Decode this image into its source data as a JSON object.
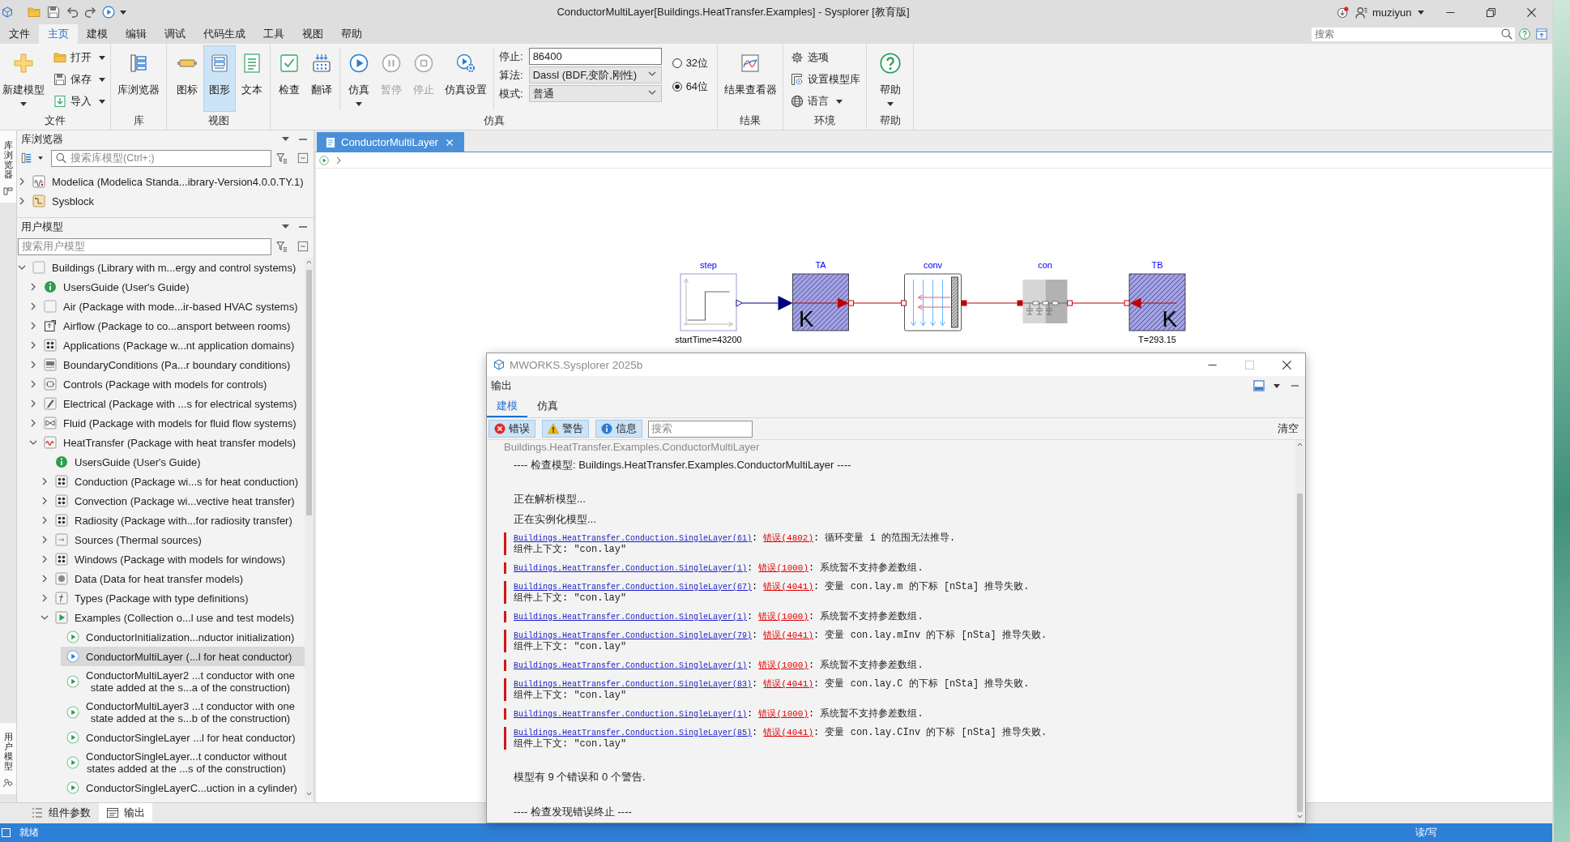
{
  "window": {
    "title": "ConductorMultiLayer[Buildings.HeatTransfer.Examples] - Sysplorer [教育版]",
    "user": "muziyun"
  },
  "menu_bar": {
    "tabs": [
      {
        "label": "文件",
        "selected": false
      },
      {
        "label": "主页",
        "selected": true
      },
      {
        "label": "建模",
        "selected": false
      },
      {
        "label": "编辑",
        "selected": false
      },
      {
        "label": "调试",
        "selected": false
      },
      {
        "label": "代码生成",
        "selected": false
      },
      {
        "label": "工具",
        "selected": false
      },
      {
        "label": "视图",
        "selected": false
      },
      {
        "label": "帮助",
        "selected": false
      }
    ],
    "search": {
      "placeholder": "搜索"
    }
  },
  "ribbon": {
    "file": {
      "label": "文件",
      "new_model": {
        "label": "新建模型",
        "dropdown": true
      },
      "actions": [
        {
          "label": "打开",
          "dropdown": true
        },
        {
          "label": "保存",
          "dropdown": true
        },
        {
          "label": "导入",
          "dropdown": true
        }
      ]
    },
    "library": {
      "label": "库",
      "browser": {
        "label": "库浏览器"
      }
    },
    "view": {
      "label": "视图",
      "modes": [
        {
          "label": "图标",
          "selected": false
        },
        {
          "label": "图形",
          "selected": true
        },
        {
          "label": "文本",
          "selected": false
        }
      ]
    },
    "simulation": {
      "label": "仿真",
      "check_actions": [
        {
          "label": "检查"
        },
        {
          "label": "翻译"
        }
      ],
      "run_actions": [
        {
          "label": "仿真",
          "disabled": false,
          "dropdown": true
        },
        {
          "label": "暂停",
          "disabled": true,
          "dropdown": false
        },
        {
          "label": "停止",
          "disabled": true,
          "dropdown": false
        },
        {
          "label": "仿真设置",
          "disabled": false,
          "dropdown": false
        }
      ],
      "settings": [
        {
          "kind": "input",
          "label": "停止:",
          "value": "86400"
        },
        {
          "kind": "select",
          "label": "算法:",
          "value": "Dassl (BDF,变阶,刚性)"
        },
        {
          "kind": "select",
          "label": "模式:",
          "value": "普通"
        }
      ],
      "platforms": [
        {
          "label": "32位",
          "selected": false
        },
        {
          "label": "64位",
          "selected": true
        }
      ]
    },
    "results": {
      "label": "结果",
      "viewer": {
        "label": "结果查看器"
      }
    },
    "environment": {
      "label": "环境",
      "actions": [
        {
          "label": "选项",
          "dropdown": false
        },
        {
          "label": "设置模型库",
          "dropdown": false
        },
        {
          "label": "语言",
          "dropdown": true
        }
      ]
    },
    "help": {
      "label": "帮助",
      "button": {
        "label": "帮助",
        "dropdown": true
      }
    }
  },
  "side_tabs": [
    {
      "label": "库浏览器"
    },
    {
      "label": "用户模型"
    }
  ],
  "library_browser": {
    "title": "库浏览器",
    "search": {
      "placeholder": "搜索库模型(Ctrl+;)"
    },
    "tree": [
      {
        "label": "Modelica (Modelica Standa...ibrary-Version4.0.0.TY.1)",
        "kind": "modelica",
        "expandable": true,
        "expanded": false,
        "selected": false
      },
      {
        "label": "Sysblock",
        "kind": "sysblock",
        "expandable": true,
        "expanded": false,
        "selected": false
      }
    ]
  },
  "user_models": {
    "title": "用户模型",
    "search": {
      "placeholder": "搜索用户模型"
    },
    "tree": [
      {
        "label": "Buildings (Library with m...ergy and control systems)",
        "kind": "library",
        "expandable": true,
        "expanded": true,
        "selected": false,
        "children": [
          {
            "label": "UsersGuide (User's Guide)",
            "kind": "guide",
            "expandable": true,
            "expanded": false,
            "selected": false
          },
          {
            "label": "Air (Package with mode...ir-based HVAC systems)",
            "kind": "plain",
            "expandable": true,
            "expanded": false,
            "selected": false
          },
          {
            "label": "Airflow (Package to co...ansport between rooms)",
            "kind": "airflow",
            "expandable": true,
            "expanded": false,
            "selected": false
          },
          {
            "label": "Applications (Package w...nt application domains)",
            "kind": "package",
            "expandable": true,
            "expanded": false,
            "selected": false
          },
          {
            "label": "BoundaryConditions (Pa...r boundary conditions)",
            "kind": "boundary",
            "expandable": true,
            "expanded": false,
            "selected": false
          },
          {
            "label": "Controls (Package with models for controls)",
            "kind": "controls",
            "expandable": true,
            "expanded": false,
            "selected": false
          },
          {
            "label": "Electrical (Package with ...s for electrical systems)",
            "kind": "electrical",
            "expandable": true,
            "expanded": false,
            "selected": false
          },
          {
            "label": "Fluid (Package with models for fluid flow systems)",
            "kind": "fluid",
            "expandable": true,
            "expanded": false,
            "selected": false
          },
          {
            "label": "HeatTransfer (Package with heat transfer models)",
            "kind": "heattransfer",
            "expandable": true,
            "expanded": true,
            "selected": false,
            "children": [
              {
                "label": "UsersGuide (User's Guide)",
                "kind": "guide",
                "expandable": false,
                "selected": false
              },
              {
                "label": "Conduction (Package wi...s for heat conduction)",
                "kind": "package",
                "expandable": true,
                "expanded": false,
                "selected": false
              },
              {
                "label": "Convection (Package wi...vective heat transfer)",
                "kind": "package",
                "expandable": true,
                "expanded": false,
                "selected": false
              },
              {
                "label": "Radiosity (Package with...for radiosity transfer)",
                "kind": "package",
                "expandable": true,
                "expanded": false,
                "selected": false
              },
              {
                "label": "Sources (Thermal sources)",
                "kind": "sources",
                "expandable": true,
                "expanded": false,
                "selected": false
              },
              {
                "label": "Windows (Package with models for windows)",
                "kind": "package",
                "expandable": true,
                "expanded": false,
                "selected": false
              },
              {
                "label": "Data (Data for heat transfer models)",
                "kind": "data",
                "expandable": true,
                "expanded": false,
                "selected": false
              },
              {
                "label": "Types (Package with type definitions)",
                "kind": "types",
                "expandable": true,
                "expanded": false,
                "selected": false
              },
              {
                "label": "Examples (Collection o...l use and test models)",
                "kind": "examples",
                "expandable": true,
                "expanded": true,
                "selected": false,
                "children": [
                  {
                    "label": "ConductorInitialization...nductor initialization)",
                    "kind": "model",
                    "expandable": false,
                    "selected": false
                  },
                  {
                    "label": "ConductorMultiLayer (...l for heat conductor)",
                    "kind": "model",
                    "expandable": false,
                    "selected": true
                  },
                  {
                    "label": "ConductorMultiLayer2 ...t conductor with one\nstate added at the s...a of the construction)",
                    "kind": "model",
                    "expandable": false,
                    "selected": false
                  },
                  {
                    "label": "ConductorMultiLayer3 ...t conductor with one\nstate added at the s...b of the construction)",
                    "kind": "model",
                    "expandable": false,
                    "selected": false
                  },
                  {
                    "label": "ConductorSingleLayer ...l for heat conductor)",
                    "kind": "model",
                    "expandable": false,
                    "selected": false
                  },
                  {
                    "label": "ConductorSingleLayer...t conductor without\nstates added at the ...s of the construction)",
                    "kind": "model",
                    "expandable": false,
                    "selected": false
                  },
                  {
                    "label": "ConductorSingleLayerC...uction in a cylinder)",
                    "kind": "model",
                    "expandable": false,
                    "selected": false
                  }
                ]
              }
            ]
          }
        ]
      }
    ]
  },
  "editor": {
    "tabs": [
      {
        "label": "ConductorMultiLayer",
        "selected": true
      }
    ],
    "diagram": {
      "components": [
        {
          "kind": "step",
          "name": "step",
          "parameter": "startTime=43200"
        },
        {
          "kind": "prescribed_temperature",
          "name": "TA",
          "unit": "K"
        },
        {
          "kind": "convection",
          "name": "conv"
        },
        {
          "kind": "conductor",
          "name": "con"
        },
        {
          "kind": "fixed_temperature",
          "name": "TB",
          "unit": "K",
          "parameter": "T=293.15"
        }
      ],
      "connections": [
        {
          "kind": "signal"
        },
        {
          "kind": "heat"
        },
        {
          "kind": "heat"
        },
        {
          "kind": "heat"
        }
      ]
    }
  },
  "output_dialog": {
    "title": "MWORKS.Sysplorer 2025b",
    "panel_title": "输出",
    "tabs": [
      {
        "label": "建模",
        "selected": true
      },
      {
        "label": "仿真",
        "selected": false
      }
    ],
    "filters": [
      {
        "kind": "error",
        "label": "错误",
        "on": true
      },
      {
        "kind": "warning",
        "label": "警告",
        "on": true
      },
      {
        "kind": "info",
        "label": "信息",
        "on": true
      }
    ],
    "search": {
      "placeholder": "搜索"
    },
    "clear_button": "清空",
    "lines": [
      {
        "kind": "path",
        "text": "Buildings.HeatTransfer.Examples.ConductorMultiLayer"
      },
      {
        "kind": "banner",
        "text": "---- 检查模型: Buildings.HeatTransfer.Examples.ConductorMultiLayer ----"
      },
      {
        "kind": "status",
        "text": "正在解析模型..."
      },
      {
        "kind": "status",
        "text": "正在实例化模型..."
      },
      {
        "kind": "error",
        "parts": [
          {
            "kind": "source",
            "text": "Buildings.HeatTransfer.Conduction.SingleLayer(61)"
          },
          {
            "kind": "plain",
            "text": ": "
          },
          {
            "kind": "code",
            "text": "错误(4802)"
          },
          {
            "kind": "plain",
            "text": ": 循环变量 i 的范围无法推导."
          }
        ],
        "context": "组件上下文: \"con.lay\""
      },
      {
        "kind": "error",
        "parts": [
          {
            "kind": "source",
            "text": "Buildings.HeatTransfer.Conduction.SingleLayer(1)"
          },
          {
            "kind": "plain",
            "text": ": "
          },
          {
            "kind": "code",
            "text": "错误(1000)"
          },
          {
            "kind": "plain",
            "text": ": 系统暂不支持参差数组."
          }
        ]
      },
      {
        "kind": "error",
        "parts": [
          {
            "kind": "source",
            "text": "Buildings.HeatTransfer.Conduction.SingleLayer(67)"
          },
          {
            "kind": "plain",
            "text": ": "
          },
          {
            "kind": "code",
            "text": "错误(4041)"
          },
          {
            "kind": "plain",
            "text": ": 变量 con.lay.m 的下标 [nSta] 推导失败."
          }
        ],
        "context": "组件上下文: \"con.lay\""
      },
      {
        "kind": "error",
        "parts": [
          {
            "kind": "source",
            "text": "Buildings.HeatTransfer.Conduction.SingleLayer(1)"
          },
          {
            "kind": "plain",
            "text": ": "
          },
          {
            "kind": "code",
            "text": "错误(1000)"
          },
          {
            "kind": "plain",
            "text": ": 系统暂不支持参差数组."
          }
        ]
      },
      {
        "kind": "error",
        "parts": [
          {
            "kind": "source",
            "text": "Buildings.HeatTransfer.Conduction.SingleLayer(79)"
          },
          {
            "kind": "plain",
            "text": ": "
          },
          {
            "kind": "code",
            "text": "错误(4041)"
          },
          {
            "kind": "plain",
            "text": ": 变量 con.lay.mInv 的下标 [nSta] 推导失败."
          }
        ],
        "context": "组件上下文: \"con.lay\""
      },
      {
        "kind": "error",
        "parts": [
          {
            "kind": "source",
            "text": "Buildings.HeatTransfer.Conduction.SingleLayer(1)"
          },
          {
            "kind": "plain",
            "text": ": "
          },
          {
            "kind": "code",
            "text": "错误(1000)"
          },
          {
            "kind": "plain",
            "text": ": 系统暂不支持参差数组."
          }
        ]
      },
      {
        "kind": "error",
        "parts": [
          {
            "kind": "source",
            "text": "Buildings.HeatTransfer.Conduction.SingleLayer(83)"
          },
          {
            "kind": "plain",
            "text": ": "
          },
          {
            "kind": "code",
            "text": "错误(4041)"
          },
          {
            "kind": "plain",
            "text": ": 变量 con.lay.C 的下标 [nSta] 推导失败."
          }
        ],
        "context": "组件上下文: \"con.lay\""
      },
      {
        "kind": "error",
        "parts": [
          {
            "kind": "source",
            "text": "Buildings.HeatTransfer.Conduction.SingleLayer(1)"
          },
          {
            "kind": "plain",
            "text": ": "
          },
          {
            "kind": "code",
            "text": "错误(1000)"
          },
          {
            "kind": "plain",
            "text": ": 系统暂不支持参差数组."
          }
        ]
      },
      {
        "kind": "error",
        "parts": [
          {
            "kind": "source",
            "text": "Buildings.HeatTransfer.Conduction.SingleLayer(85)"
          },
          {
            "kind": "plain",
            "text": ": "
          },
          {
            "kind": "code",
            "text": "错误(4041)"
          },
          {
            "kind": "plain",
            "text": ": 变量 con.lay.CInv 的下标 [nSta] 推导失败."
          }
        ],
        "context": "组件上下文: \"con.lay\""
      },
      {
        "kind": "summary",
        "text": "模型有 9 个错误和 0 个警告."
      },
      {
        "kind": "banner",
        "text": "---- 检查发现错误终止 ----"
      }
    ]
  },
  "bottom_tabs": [
    {
      "label": "组件参数",
      "selected": false
    },
    {
      "label": "输出",
      "selected": true
    }
  ],
  "status_bar": {
    "message": "就绪",
    "mode": "读/写"
  }
}
